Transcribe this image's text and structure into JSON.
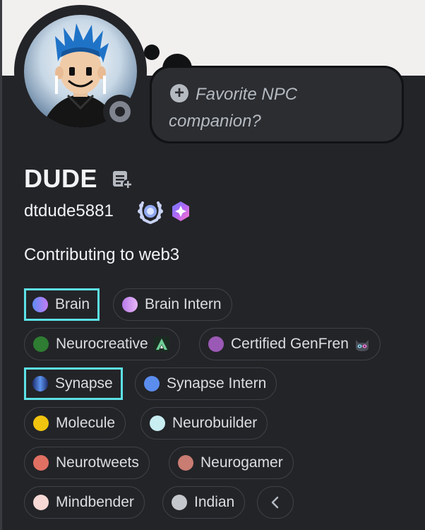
{
  "profile": {
    "display_name": "DUDE",
    "username": "dtdude5881",
    "about": "Contributing to web3",
    "custom_status": "Favorite NPC companion?",
    "status": "offline"
  },
  "roles": [
    {
      "name": "Brain",
      "color": "#8e7cf6",
      "gradient": [
        "#5e8cf6",
        "#c47cf6"
      ],
      "highlighted": true
    },
    {
      "name": "Brain Intern",
      "color": "#c98bf2",
      "gradient": [
        "#b77ae8",
        "#e9b8f7"
      ],
      "highlighted": false
    },
    {
      "name": "Neurocreative",
      "color": "#2e7d32",
      "icon": "creative-icon",
      "highlighted": false
    },
    {
      "name": "Certified GenFren",
      "color": "#9b59b6",
      "icon": "cat-icon",
      "highlighted": false
    },
    {
      "name": "Synapse",
      "color": "#3b6fd4",
      "gradient": [
        "#1e2f6e",
        "#5d94f0"
      ],
      "highlighted": true
    },
    {
      "name": "Synapse Intern",
      "color": "#5b8def",
      "highlighted": false
    },
    {
      "name": "Molecule",
      "color": "#f1c40f",
      "highlighted": false
    },
    {
      "name": "Neurobuilder",
      "color": "#c8eef2",
      "highlighted": false
    },
    {
      "name": "Neurotweets",
      "color": "#e07062",
      "highlighted": false
    },
    {
      "name": "Neurogamer",
      "color": "#c97c72",
      "highlighted": false
    },
    {
      "name": "Mindbender",
      "color": "#f6d9d5",
      "highlighted": false
    },
    {
      "name": "Indian",
      "color": "#c4c7cc",
      "highlighted": false
    }
  ],
  "colors": {
    "background": "#232428",
    "banner": "#f2f0ef",
    "highlight_border": "#5ce1e6"
  },
  "icons": [
    "note-add-icon",
    "laurel-badge-icon",
    "nitro-badge-icon",
    "chevron-left-icon",
    "add-status-icon"
  ]
}
